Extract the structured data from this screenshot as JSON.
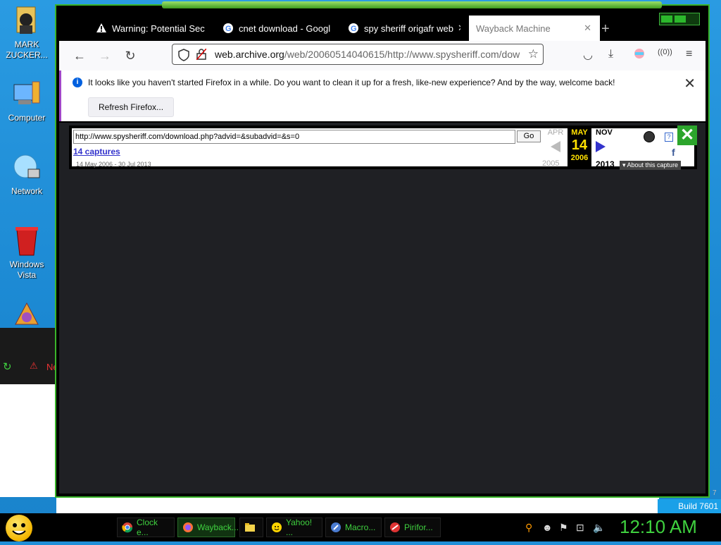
{
  "desktop": {
    "icons": [
      {
        "label": "MARK ZUCKER...",
        "icon": "user-icon"
      },
      {
        "label": "Computer",
        "icon": "computer-icon"
      },
      {
        "label": "Network",
        "icon": "network-icon"
      },
      {
        "label": "Windows Vista",
        "icon": "recycle-bin-icon"
      },
      {
        "label": "",
        "icon": "app-icon"
      }
    ],
    "bg_window_label": "Ne"
  },
  "browser": {
    "tabs": [
      {
        "label": "Warning: Potential Sec",
        "icon": "warning-icon"
      },
      {
        "label": "cnet download - Googl",
        "icon": "google-icon"
      },
      {
        "label": "spy sheriff origafr web",
        "icon": "google-icon"
      },
      {
        "label": "Wayback Machine",
        "icon": "",
        "active": true
      }
    ],
    "url": {
      "host": "web.archive.org",
      "path": "/web/20060514040615/http://www.spysheriff.com/dow"
    },
    "infobar": {
      "message": "It looks like you haven't started Firefox in a while. Do you want to clean it up for a fresh, like-new experience? And by the way, welcome back!",
      "button": "Refresh Firefox..."
    }
  },
  "wayback": {
    "url_value": "http://www.spysheriff.com/download.php?advid=&subadvid=&s=0",
    "go_label": "Go",
    "captures": "14 captures",
    "range": "14 May 2006 - 30 Jul 2013",
    "prev_month": "APR",
    "prev_year": "2005",
    "cur_month": "MAY",
    "cur_day": "14",
    "cur_year": "2006",
    "next_month": "NOV",
    "next_year": "2013",
    "about": "▾ About this capture",
    "help": "?",
    "fb": "f"
  },
  "taskbar": {
    "items": [
      {
        "label": "Clock e...",
        "icon": "chrome-icon"
      },
      {
        "label": "Wayback...",
        "icon": "firefox-icon",
        "active": true
      },
      {
        "label": "",
        "icon": "folder-icon"
      },
      {
        "label": "Yahoo! ...",
        "icon": "yahoo-icon"
      },
      {
        "label": "Macro...",
        "icon": "macro-icon"
      },
      {
        "label": "Pirifor...",
        "icon": "piriform-icon"
      }
    ],
    "clock": "12:10 AM",
    "build": "Build 7601",
    "edge_number": "7"
  },
  "colors": {
    "accent_green": "#3fd13f",
    "desktop_blue": "#1f8fd8"
  }
}
